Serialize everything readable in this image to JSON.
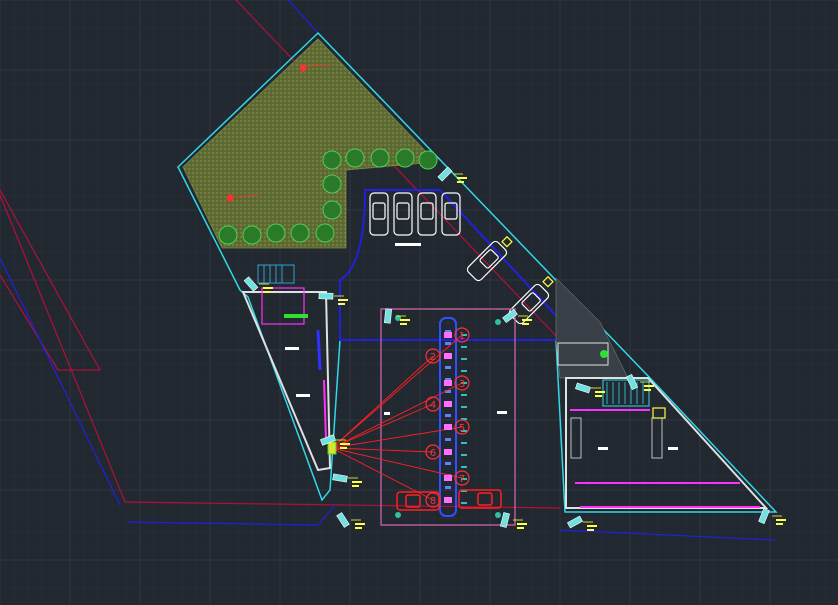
{
  "viewport": {
    "background": "#212830",
    "grid_major": "#2d3540",
    "grid_minor": "#262d36"
  },
  "colors": {
    "property_line": "#d01040",
    "road_edge": "#1a1ae6",
    "site_boundary": "#30d8e8",
    "lawn": "#6b7a3a",
    "trees": "#3ab03a",
    "building_walls": "#e8e8e8",
    "canopy": "#c060a0",
    "fuel_line": "#ff2020",
    "pump_marker": "#ff3030",
    "car_parked": "#ffffff",
    "car_red": "#ff2020",
    "annotation": "#ffff40",
    "accent_magenta": "#ff30ff",
    "accent_green": "#30e030"
  },
  "pumps": {
    "labels": [
      "1",
      "2",
      "3",
      "4",
      "5",
      "6",
      "7",
      "8"
    ]
  },
  "icons": {
    "tree": "tree-icon",
    "car": "car-icon",
    "pump": "fuel-pump-icon",
    "light": "light-fixture-icon",
    "stair": "stair-icon"
  }
}
